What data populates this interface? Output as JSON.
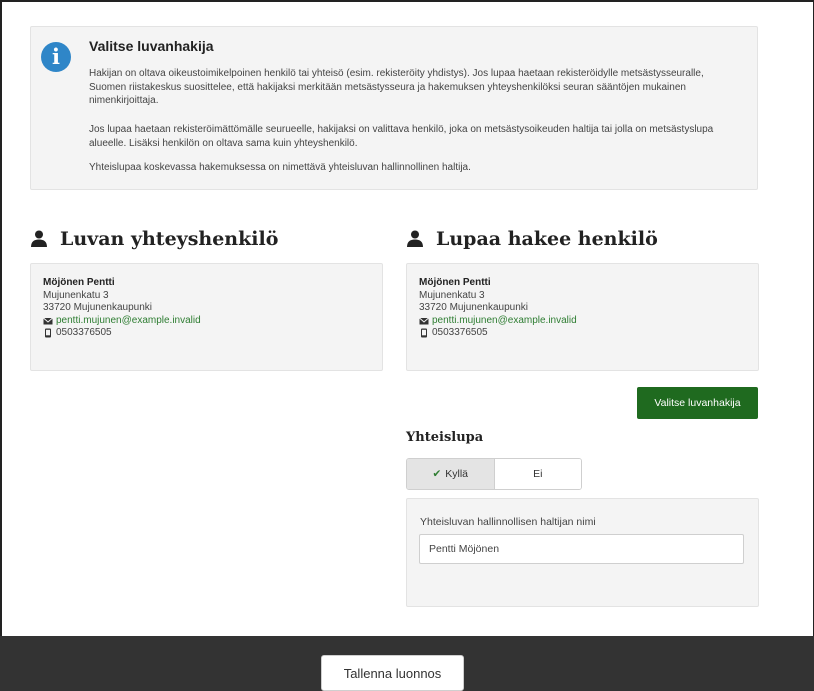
{
  "info": {
    "icon": "info-icon",
    "icon_glyph": "i",
    "title": "Valitse luvanhakija",
    "paragraphs": [
      "Hakijan on oltava oikeustoimikelpoinen henkilö tai yhteisö (esim. rekisteröity yhdistys). Jos lupaa haetaan rekisteröidylle metsästysseuralle, Suomen riistakeskus suosittelee, että hakijaksi merkitään metsästysseura ja hakemuksen yhteyshenkilöksi seuran sääntöjen mukainen nimenkirjoittaja.",
      "Jos lupaa haetaan rekisteröimättömälle seurueelle, hakijaksi on valittava henkilö, joka on metsästysoikeuden haltija tai jolla on metsästyslupa alueelle. Lisäksi henkilön on oltava sama kuin yhteyshenkilö.",
      "Yhteislupaa koskevassa hakemuksessa on nimettävä yhteisluvan hallinnollinen haltija."
    ]
  },
  "contact_section": {
    "title": "Luvan yhteyshenkilö",
    "icon": "person-icon",
    "name": "Möjönen Pentti",
    "street": "Mujunenkatu 3",
    "city": "33720 Mujunenkaupunki",
    "email": "pentti.mujunen@example.invalid",
    "phone": "0503376505"
  },
  "applicant_section": {
    "title": "Lupaa hakee henkilö",
    "icon": "person-icon",
    "name": "Möjönen Pentti",
    "street": "Mujunenkatu 3",
    "city": "33720 Mujunenkaupunki",
    "email": "pentti.mujunen@example.invalid",
    "phone": "0503376505",
    "select_button": "Valitse luvanhakija"
  },
  "yhteislupa": {
    "title": "Yhteislupa",
    "options": [
      "Kyllä",
      "Ei"
    ],
    "selected": "Kyllä",
    "field_label": "Yhteisluvan hallinnollisen haltijan nimi",
    "field_value": "Pentti Möjönen"
  },
  "footer": {
    "save_button": "Tallenna luonnos"
  },
  "colors": {
    "primary": "#1f6a1f",
    "info_icon": "#2f86c8",
    "link": "#2e7d32",
    "footer_bg": "#333333"
  }
}
